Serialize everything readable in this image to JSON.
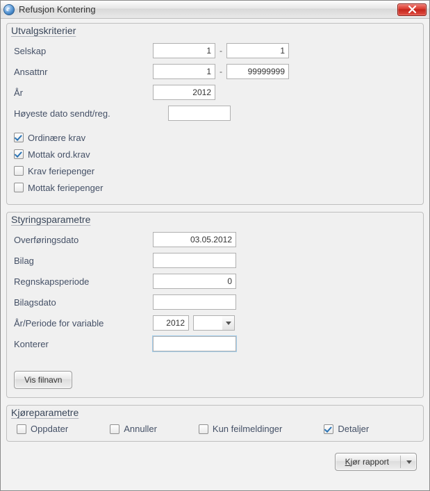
{
  "window": {
    "title": "Refusjon Kontering"
  },
  "grp1": {
    "legend": "Utvalgskriterier",
    "selskap_label": "Selskap",
    "selskap_from": "1",
    "selskap_to": "1",
    "ansattnr_label": "Ansattnr",
    "ansattnr_from": "1",
    "ansattnr_to": "99999999",
    "aar_label": "År",
    "aar_value": "2012",
    "hoyeste_label": "Høyeste dato sendt/reg.",
    "hoyeste_value": "",
    "check_ord_label": "Ordinære krav",
    "check_ord_val": true,
    "check_mottak_label": "Mottak ord.krav",
    "check_mottak_val": true,
    "check_ferie_label": "Krav feriepenger",
    "check_ferie_val": false,
    "check_mottakferie_label": "Mottak feriepenger",
    "check_mottakferie_val": false
  },
  "grp2": {
    "legend": "Styringsparametre",
    "overfor_label": "Overføringsdato",
    "overfor_value": "03.05.2012",
    "bilag_label": "Bilag",
    "bilag_value": "",
    "regnskap_label": "Regnskapsperiode",
    "regnskap_value": "0",
    "bilagsdato_label": "Bilagsdato",
    "bilagsdato_value": "",
    "aarperiode_label": "År/Periode for variable",
    "aarperiode_year": "2012",
    "aarperiode_period": "",
    "konterer_label": "Konterer",
    "konterer_value": "",
    "visfilnavn_label": "Vis filnavn"
  },
  "grp3": {
    "legend": "Kjøreparametre",
    "oppdater_label": "Oppdater",
    "oppdater_val": false,
    "annuller_label": "Annuller",
    "annuller_val": false,
    "kunfeil_label": "Kun feilmeldinger",
    "kunfeil_val": false,
    "detaljer_label": "Detaljer",
    "detaljer_val": true
  },
  "footer": {
    "run_pre": "K",
    "run_mid": "jør rapport"
  }
}
